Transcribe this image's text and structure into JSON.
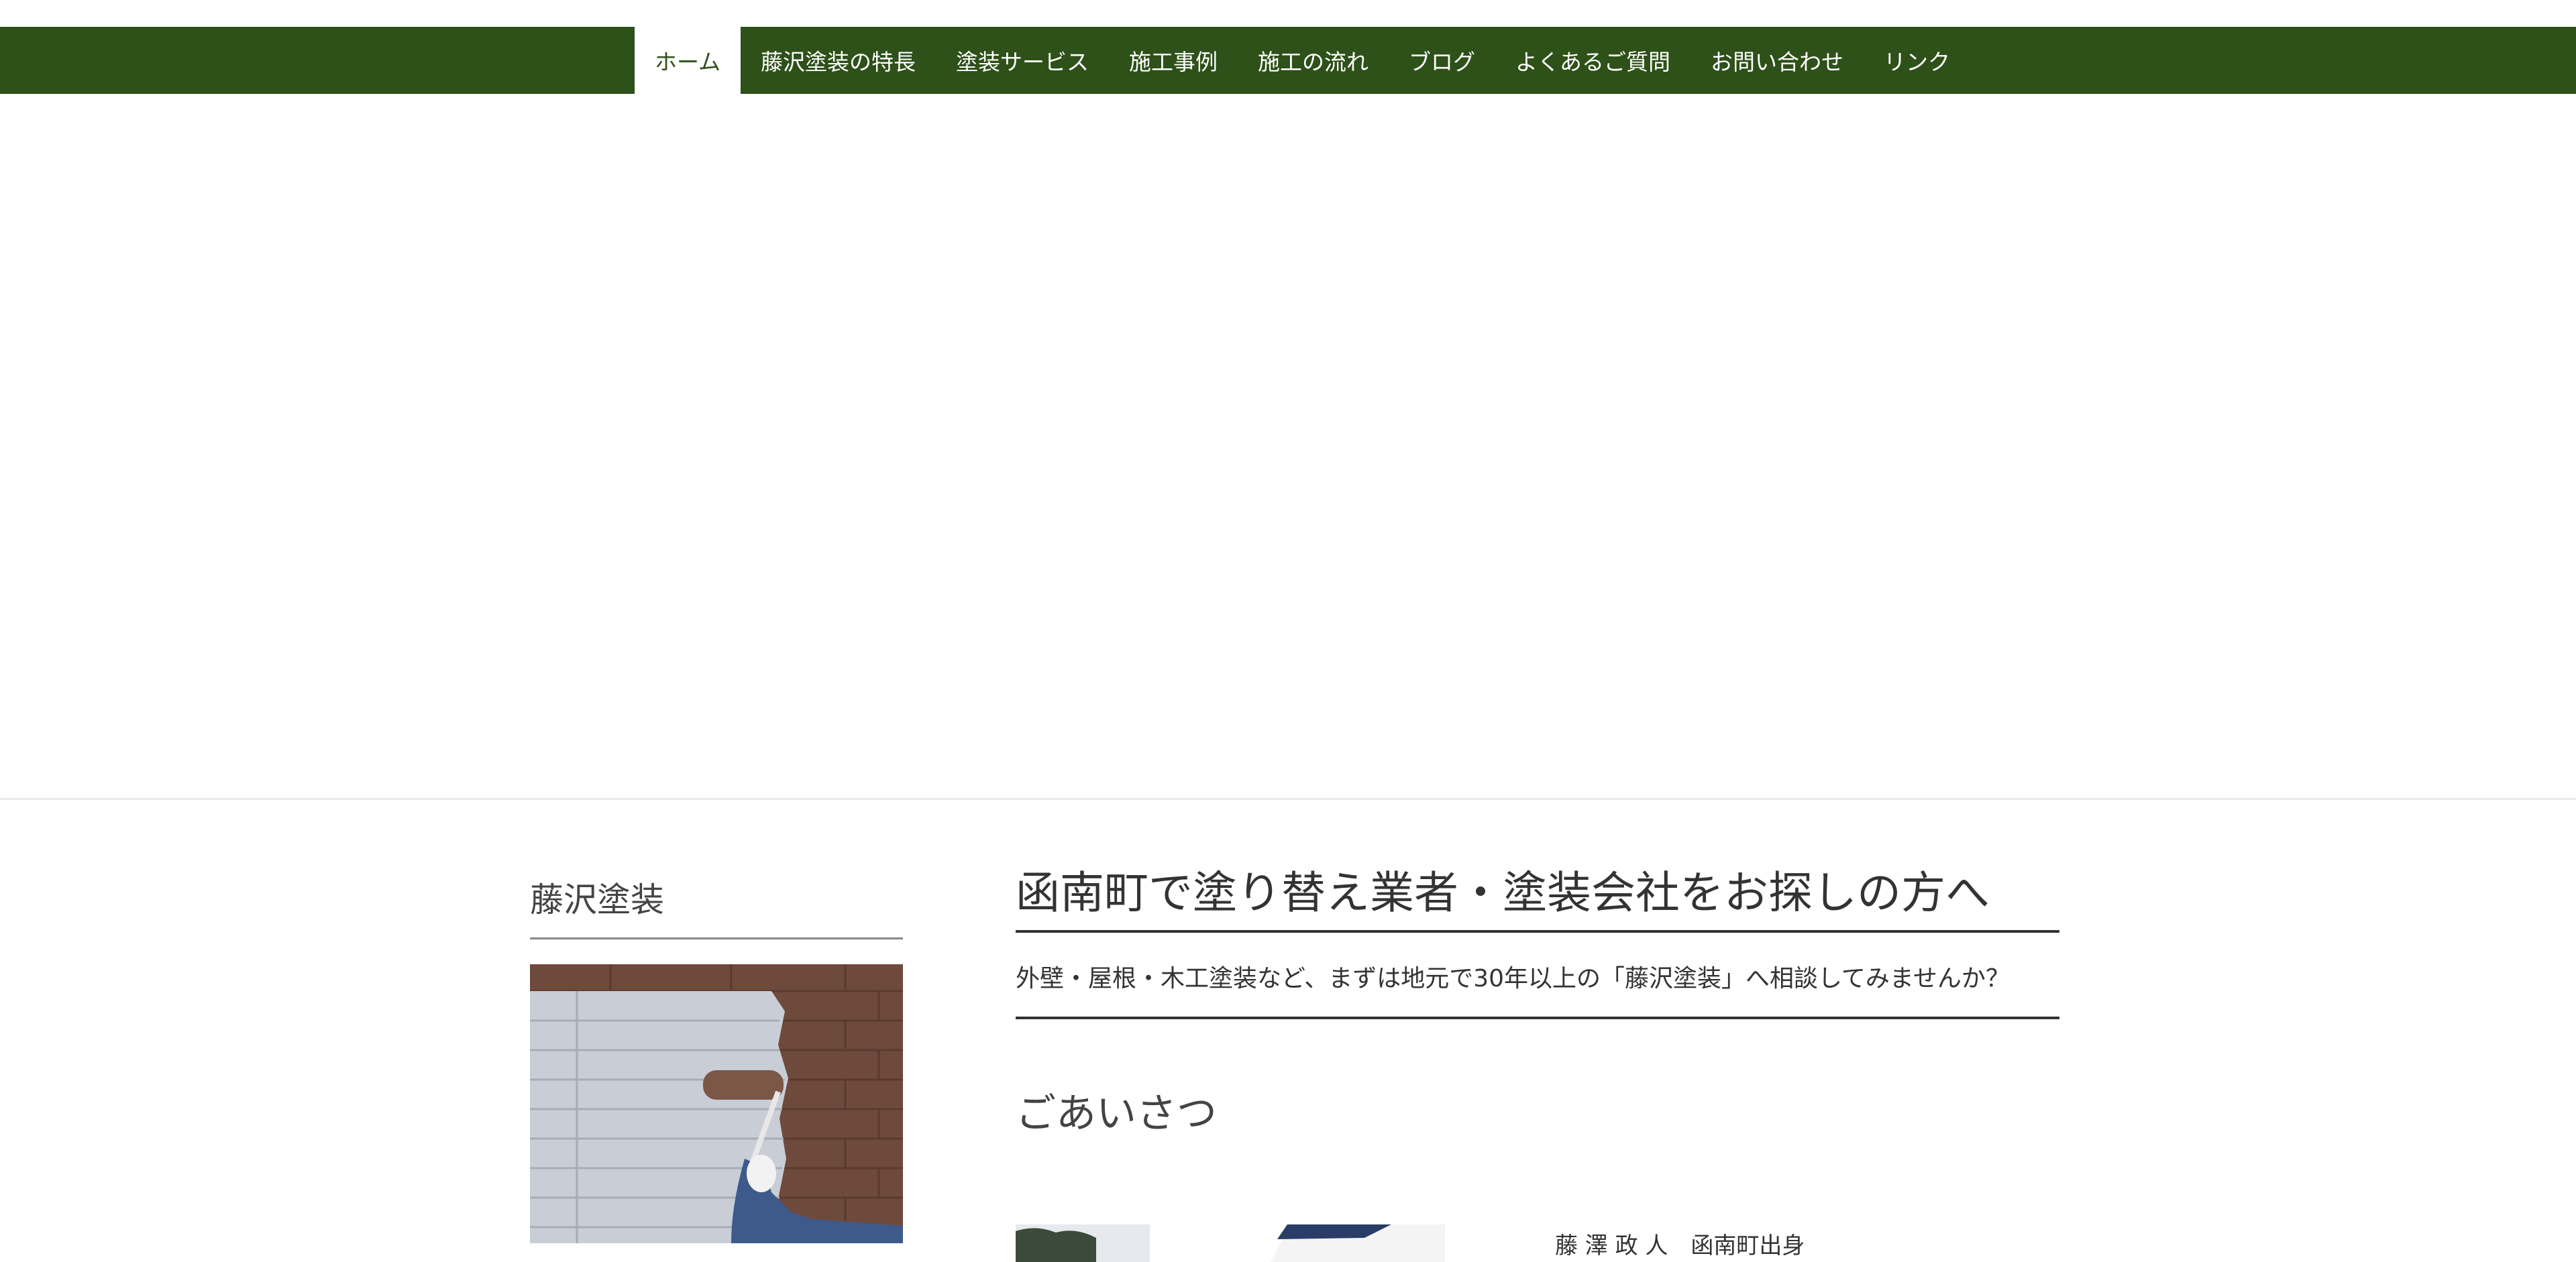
{
  "nav": {
    "items": [
      {
        "label": "ホーム",
        "active": true
      },
      {
        "label": "藤沢塗装の特長"
      },
      {
        "label": "塗装サービス"
      },
      {
        "label": "施工事例"
      },
      {
        "label": "施工の流れ"
      },
      {
        "label": "ブログ"
      },
      {
        "label": "よくあるご質問"
      },
      {
        "label": "お問い合わせ"
      },
      {
        "label": "リンク"
      }
    ]
  },
  "sidebar": {
    "title": "藤沢塗装"
  },
  "main": {
    "title": "函南町で塗り替え業者・塗装会社をお探しの方へ",
    "lead": "外壁・屋根・木工塗装など、まずは地元で30年以上の「藤沢塗装」へ相談してみませんか？",
    "greeting_title": "ごあいさつ",
    "profile_line": "藤 澤 政 人　函南町出身"
  },
  "colors": {
    "nav_bg": "#2e5019",
    "nav_text": "#ffffff",
    "nav_active_bg": "#ffffff",
    "nav_active_text": "#2e5019"
  }
}
